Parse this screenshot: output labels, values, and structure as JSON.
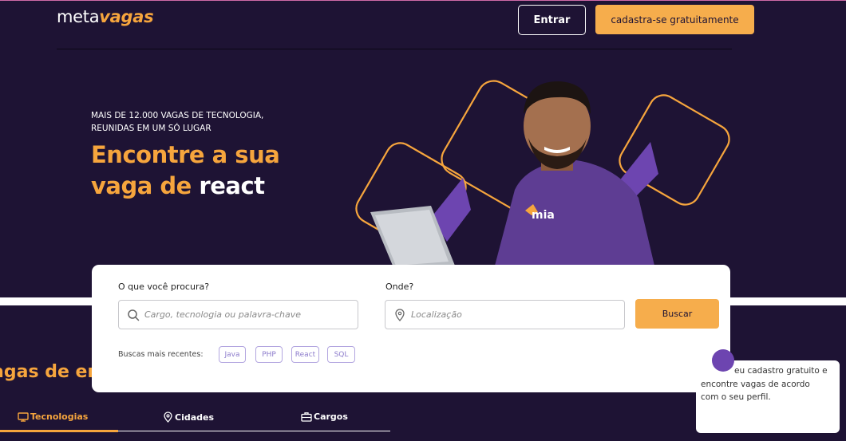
{
  "header": {
    "logo_main": "meta",
    "logo_accent": "vagas",
    "login_label": "Entrar",
    "signup_label": "cadastra-se gratuitamente"
  },
  "hero": {
    "subtitle_line1": "MAIS DE 12.000 VAGAS DE TECNOLOGIA,",
    "subtitle_line2": "REUNIDAS EM UM SÓ LUGAR",
    "title_line1": "Encontre a sua",
    "title_line2_prefix": "vaga de ",
    "title_line2_word": "react",
    "shirt_brand": "mia"
  },
  "search": {
    "what_label": "O que você procura?",
    "what_placeholder": "Cargo, tecnologia ou palavra-chave",
    "where_label": "Onde?",
    "where_placeholder": "Localização",
    "button_label": "Buscar",
    "recent_label": "Buscas mais recentes:",
    "recent_chips": [
      "Java",
      "PHP",
      "React",
      "SQL"
    ]
  },
  "section": {
    "title": "agas de em"
  },
  "tabs": [
    {
      "label": "Tecnologias",
      "icon": "monitor-icon",
      "active": true
    },
    {
      "label": "Cidades",
      "icon": "map-pin-icon",
      "active": false
    },
    {
      "label": "Cargos",
      "icon": "briefcase-icon",
      "active": false
    }
  ],
  "chat": {
    "line1": "eu cadastro gratuito e",
    "line2": "encontre vagas de acordo",
    "line3": "com o seu perfil."
  },
  "colors": {
    "background": "#1e1334",
    "accent_orange": "#f6a53d",
    "button_orange": "#f6ad4c",
    "purple": "#6d45b0"
  }
}
